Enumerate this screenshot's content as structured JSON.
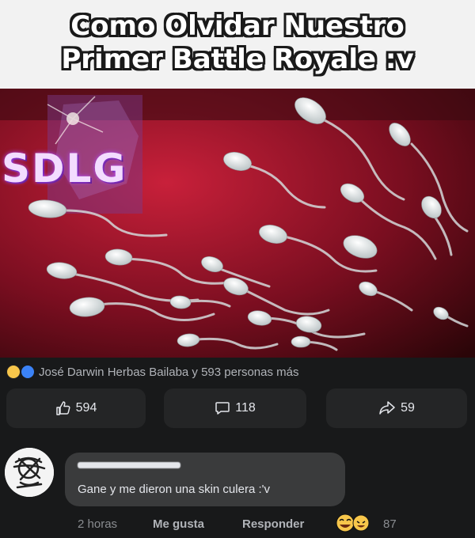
{
  "caption": {
    "line1": "Como Olvidar Nuestro",
    "line2": "Primer Battle Royale :v"
  },
  "image": {
    "logo": "SDLG"
  },
  "post": {
    "reactions_text": "José Darwin Herbas Bailaba y 593 personas más",
    "likes": "594",
    "comments": "118",
    "shares": "59"
  },
  "comment": {
    "text": "Gane y me dieron una skin culera :'v",
    "time": "2 horas",
    "like_label": "Me gusta",
    "reply_label": "Responder",
    "reaction_count": "87"
  },
  "colors": {
    "background": "#18191a",
    "pill": "#242526",
    "bubble": "#3a3b3c",
    "text": "#e4e6eb"
  }
}
